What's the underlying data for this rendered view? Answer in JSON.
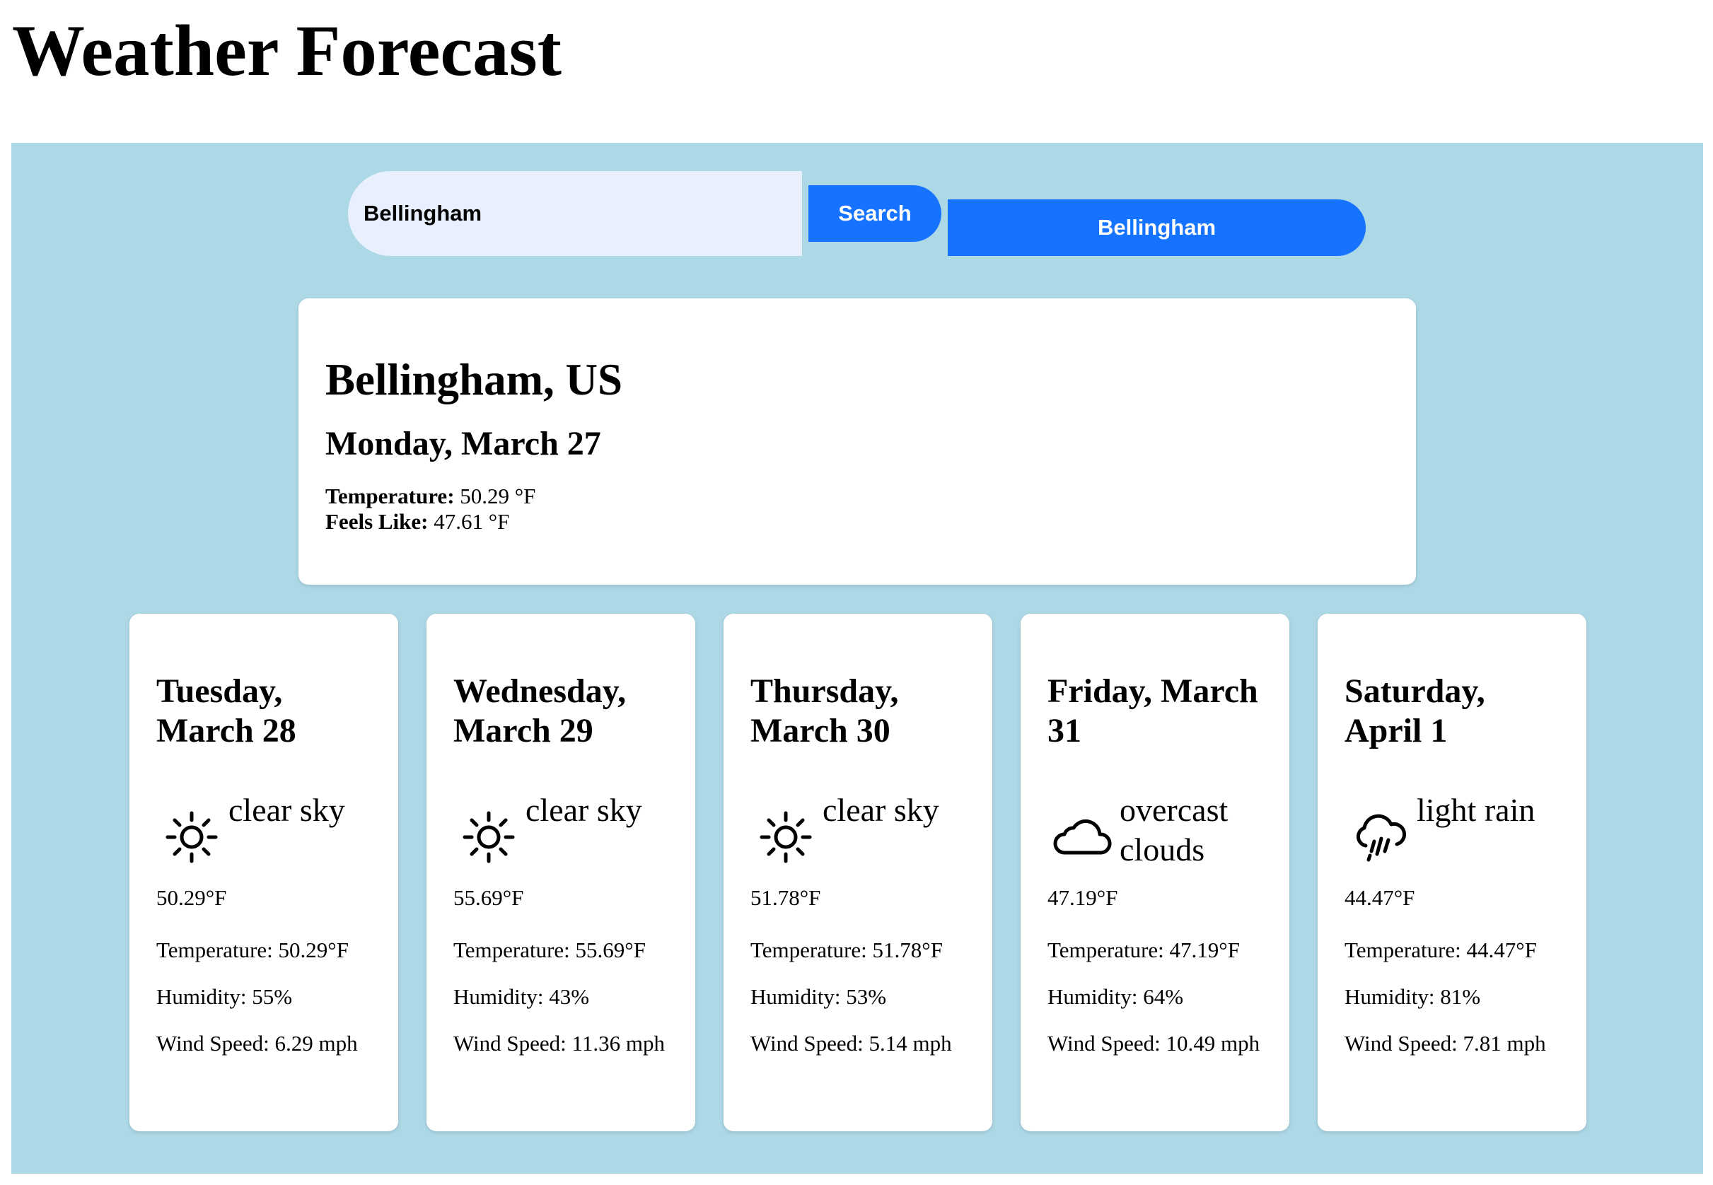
{
  "page": {
    "title": "Weather Forecast"
  },
  "search": {
    "value": "Bellingham",
    "button_label": "Search",
    "history": [
      "Bellingham"
    ]
  },
  "current": {
    "city": "Bellingham, US",
    "date": "Monday, March 27",
    "temperature_label": "Temperature:",
    "temperature_value": "50.29 °F",
    "feels_like_label": "Feels Like:",
    "feels_like_value": "47.61 °F"
  },
  "forecast": [
    {
      "date": "Tuesday, March 28",
      "icon": "sun-icon",
      "description": "clear sky",
      "temp": "50.29°F",
      "temperature": "Temperature: 50.29°F",
      "humidity": "Humidity: 55%",
      "wind": "Wind Speed: 6.29 mph"
    },
    {
      "date": "Wednesday, March 29",
      "icon": "sun-icon",
      "description": "clear sky",
      "temp": "55.69°F",
      "temperature": "Temperature: 55.69°F",
      "humidity": "Humidity: 43%",
      "wind": "Wind Speed: 11.36 mph"
    },
    {
      "date": "Thursday, March 30",
      "icon": "sun-icon",
      "description": "clear sky",
      "temp": "51.78°F",
      "temperature": "Temperature: 51.78°F",
      "humidity": "Humidity: 53%",
      "wind": "Wind Speed: 5.14 mph"
    },
    {
      "date": "Friday, March 31",
      "icon": "cloud-icon",
      "description": "overcast clouds",
      "temp": "47.19°F",
      "temperature": "Temperature: 47.19°F",
      "humidity": "Humidity: 64%",
      "wind": "Wind Speed: 10.49 mph"
    },
    {
      "date": "Saturday, April 1",
      "icon": "rain-cloud-icon",
      "description": "light rain",
      "temp": "44.47°F",
      "temperature": "Temperature: 44.47°F",
      "humidity": "Humidity: 81%",
      "wind": "Wind Speed: 7.81 mph"
    }
  ],
  "colors": {
    "background": "#add8e6",
    "button": "#1673ff",
    "input": "#e8f0fe",
    "card": "#ffffff"
  }
}
